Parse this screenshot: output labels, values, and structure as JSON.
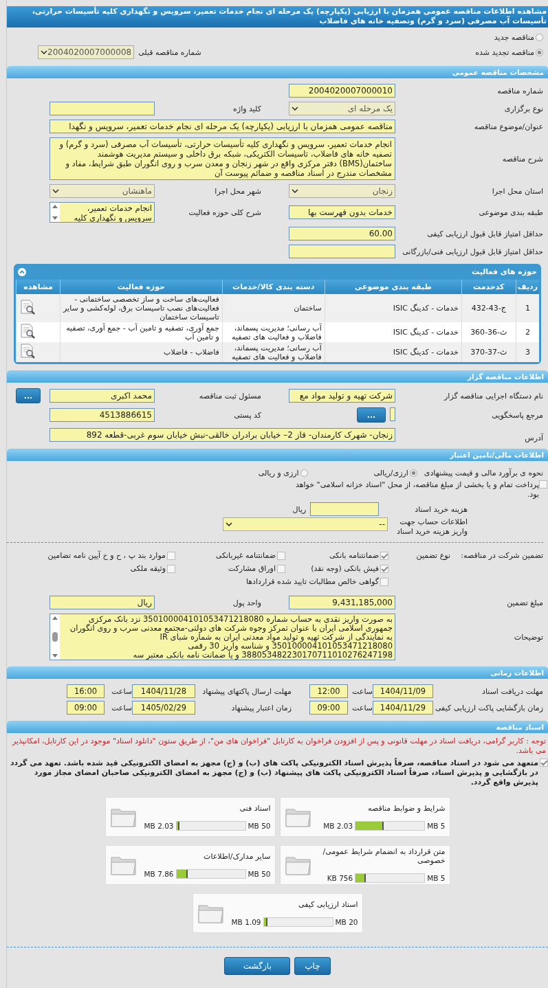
{
  "title": "مشاهده اطلاعات مناقصه عمومی همزمان با ارزیابی (یکپارچه) یک مرحله ای نجام خدمات تعمیر، سرویس و نگهداری کلیه تأسیسات حرارتی، تأسیسات آب مصرفی (سرد و گرم) وتصفیه خانه های فاضلاب",
  "tender_type": [
    {
      "label": "مناقصه جدید",
      "selected": false
    },
    {
      "label": "مناقصه تجدید شده",
      "selected": true
    }
  ],
  "previous_tender": {
    "label": "شماره مناقصه قبلی",
    "value": "2004020007000008"
  },
  "general": {
    "heading": "مشخصات مناقصه عمومی",
    "tender_number": {
      "label": "شماره مناقصه",
      "value": "2004020007000010"
    },
    "holding_type": {
      "label": "نوع برگزاری",
      "value": "یک مرحله ای"
    },
    "keyword": {
      "label": "کلید واژه"
    },
    "subject": {
      "label": "عنوان/موضوع مناقصه",
      "value": "مناقصه عمومی همزمان با ارزیابی (یکپارچه) یک مرحله ای نجام خدمات تعمیر، سرویس و نگهدا"
    },
    "description": {
      "label": "شرح مناقصه",
      "value": "انجام خدمات تعمیر، سرویس و نگهداری کلیه تأسیسات حرارتی، تأسیسات آب مصرفی (سرد و گرم) و تصفیه خانه های فاضلاب، تاسیسات الکتریکی، شبکه برق داخلی و سیستم مدیریت هوشمند ساختمان(BMS) دفتر مرکزی واقع در شهر زنجان و معدن سرب و روی انگوران طبق شرایط، مفاد و مشخصات مندرج  در اسناد مناقصه و ضمائم پیوست آن"
    },
    "province": {
      "label": "استان محل اجرا",
      "value": "زنجان"
    },
    "city": {
      "label": "شهر محل اجرا",
      "value": "ماهنشان"
    },
    "category": {
      "label": "طبقه بندی موضوعی",
      "value": "خدمات بدون فهرست بها"
    },
    "activity_scope": {
      "label": "شرح کلی حوزه فعالیت",
      "value": "انجام خدمات تعمیر، سرویس و نگهداری کلیه"
    },
    "min_quality_score": {
      "label": "حداقل امتیاز قابل قبول ارزیابی کیفی",
      "value": "60.00"
    },
    "min_technical_score": {
      "label": "حداقل امتیاز قابل قبول ارزیابی فنی/بازرگانی"
    }
  },
  "activities": {
    "heading": "حوزه های فعالیت",
    "columns": [
      "ردیف",
      "کدخدمت",
      "طبقه بندی موضوعی",
      "دسته بندی کالا/خدمات",
      "حوزه فعالیت",
      "مشاهده"
    ],
    "rows": [
      {
        "row": "1",
        "code": "ج-43-432",
        "category": "خدمات - کدینگ ISIC",
        "goods": "ساختمان",
        "scope": "فعالیت‌های ساخت و ساز تخصصی ساختمانی - فعالیت‌های نصب تاسیسات برق، لوله‌کشی و سایر تاسیسات ساختمان"
      },
      {
        "row": "2",
        "code": "ث-36-360",
        "category": "خدمات - کدینگ ISIC",
        "goods": "آب رسانی؛ مدیریت پسماند، فاضلاب و فعالیت های تصفیه",
        "scope": "جمع آوری، تصفیه و تامین آب - جمع آوری، تصفیه و تامین آب"
      },
      {
        "row": "3",
        "code": "ث-37-370",
        "category": "خدمات - کدینگ ISIC",
        "goods": "آب رسانی؛ مدیریت پسماند، فاضلاب و فعالیت های تصفیه",
        "scope": "فاضلاب - فاضلاب"
      }
    ]
  },
  "tenderer": {
    "heading": "اطلاعات مناقصه گزار",
    "agency": {
      "label": "نام دستگاه اجرایی مناقصه گزار",
      "value": "شرکت تهیه و تولید مواد مع"
    },
    "responsible": {
      "label": "مسئول ثبت مناقصه",
      "value": "محمد اکبری",
      "button": "..."
    },
    "reference": {
      "label": "مرجع پاسخگویی",
      "button": "..."
    },
    "postal_code": {
      "label": "کد پستی",
      "value": "4513886615"
    },
    "address": {
      "label": "آدرس",
      "value": "زنجان- شهرک کارمندان- فاز 2– خیابان برادران خالقی-نبش خیابان سوم غربی-قطعه 892"
    }
  },
  "financial": {
    "heading": "اطلاعات مالی/تامین اعتبار",
    "estimate_method": {
      "label": "نحوه ی برآورد مالی و قیمت پیشنهادی",
      "options": [
        {
          "label": "ارزی/ریالی",
          "selected": true
        },
        {
          "label": "ارزی و ریالی",
          "selected": false
        }
      ]
    },
    "treasury": {
      "label": "پرداخت تمام و یا بخشی از مبلغ مناقصه، از محل \"اسناد خزانه اسلامی\" خواهد بود.",
      "checked": false
    },
    "doc_fee": {
      "label": "هزینه خرید اسناد",
      "unit": "ریال"
    },
    "account": {
      "label": "اطلاعات حساب جهت واریز هزینه خرید اسناد",
      "value": "--"
    },
    "guarantee": {
      "label": "تضمین شرکت در مناقصه:",
      "type_label": "نوع تضمین",
      "options": [
        {
          "label": "ضمانتنامه بانکی",
          "checked": true
        },
        {
          "label": "ضمانتنامه غیربانکی",
          "checked": false
        },
        {
          "label": "موارد بند پ ، ح و خ آیین نامه تضامین",
          "checked": false
        },
        {
          "label": "فیش بانکی (وجه نقد)",
          "checked": true
        },
        {
          "label": "اوراق مشارکت",
          "checked": false
        },
        {
          "label": "وثیقه ملکی",
          "checked": false
        },
        {
          "label": "گواهی خالص مطالبات تایید شده قراردادها",
          "checked": false
        }
      ]
    },
    "amount": {
      "label": "مبلغ تضمین",
      "value": "9,431,185,000"
    },
    "currency": {
      "label": "واحد پول",
      "value": "ریال"
    },
    "notes": {
      "label": "توضیحات",
      "value": "به صورت واریز نقدی به حساب شماره 350100004101053471218080 نزد بانک مرکزی جمهوری اسلامی ایران با عنوان تمرکز وجوه شرکت های دولتی-مجتمع معدنی سرب و روی انگوران به نمایندگی از شرکت تهیه و تولید مواد معدنی ایران به شماره شبای IR 350100004101053471218080 و شناسه واریز 30 رقمی 388053482230170711010276247198 و یا ضمانت نامه بانکی معتبر سه"
    }
  },
  "timing": {
    "heading": "اطلاعات زمانی",
    "items": [
      {
        "label": "مهلت دریافت اسناد",
        "date": "1404/11/09",
        "time_label": "ساعت",
        "time": "12:00"
      },
      {
        "label": "مهلت ارسال پاکتهای پیشنهاد",
        "date": "1404/11/28",
        "time_label": "ساعت",
        "time": "16:00"
      },
      {
        "label": "زمان بازگشایی پاکت ارزیابی کیفی",
        "date": "1404/11/29",
        "time_label": "ساعت",
        "time": "09:00"
      },
      {
        "label": "زمان اعتبار پیشنهاد",
        "date": "1405/02/29",
        "time_label": "ساعت",
        "time": "09:00"
      }
    ]
  },
  "documents": {
    "heading": "اسناد مناقصه",
    "notice": "توجه : کاربر گرامی، دریافت اسناد در مهلت قانونی و پس از افزودن فراخوان به کارتابل \"فراخوان های من\"، از طریق ستون \"دانلود اسناد\" موجود در این کارتابل، امکانپذیر می باشد.",
    "commitment": {
      "text": "متعهد می شود در اسناد مناقصه، صرفاً پذیرش اسناد الکترونیکی پاکت های (ب) و (ج) مجهز به امضای الکترونیکی قید شده باشد. تعهد می گردد در بازگشایی و پذیرش اسناد، صرفاً اسناد الکترونیکی پاکت های پیشنهاد (ب) و (ج) مجهز به امضای الکترونیکی صاحبان امضای مجاز مورد پذیرش واقع گردد.",
      "checked": true
    },
    "files": [
      {
        "name": "شرایط و ضوابط مناقصه",
        "max": "5 MB",
        "size": "2.03 MB",
        "level": 0.41
      },
      {
        "name": "اسناد فنی",
        "max": "50 MB",
        "size": "2.03 MB",
        "level": 0.04
      },
      {
        "name": "متن قرارداد به انضمام شرایط عمومی/خصوصی",
        "max": "5 MB",
        "size": "756 KB",
        "level": 0.15
      },
      {
        "name": "سایر مدارک/اطلاعات",
        "max": "50 MB",
        "size": "7.86 MB",
        "level": 0.16
      },
      {
        "name": "اسناد ارزیابی کیفی",
        "max": "20 MB",
        "size": "1.09 MB",
        "level": 0.05
      }
    ]
  },
  "buttons": [
    {
      "label": "چاپ"
    },
    {
      "label": "بازگشت"
    }
  ]
}
